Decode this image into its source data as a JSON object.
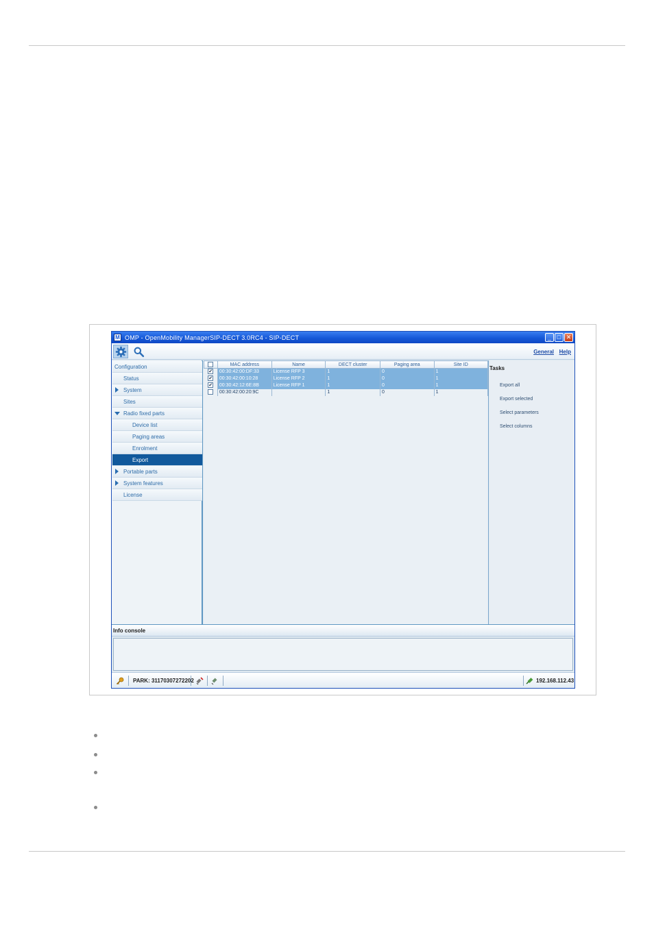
{
  "window": {
    "title": "OMP - OpenMobility ManagerSIP-DECT 3.0RC4 - SIP-DECT",
    "app_icon": "M",
    "controls": {
      "minimize": "_",
      "maximize": "□",
      "close": "✕"
    }
  },
  "toolbar": {
    "tools": [
      "gear-icon",
      "search-icon"
    ],
    "links": {
      "general": "General",
      "help": "Help"
    }
  },
  "nav": {
    "items": [
      {
        "label": "Configuration",
        "level": 0,
        "arrow": ""
      },
      {
        "label": "Status",
        "level": 1,
        "arrow": ""
      },
      {
        "label": "System",
        "level": 1,
        "arrow": "right"
      },
      {
        "label": "Sites",
        "level": 1,
        "arrow": ""
      },
      {
        "label": "Radio fixed parts",
        "level": 1,
        "arrow": "down"
      },
      {
        "label": "Device list",
        "level": 2,
        "arrow": ""
      },
      {
        "label": "Paging areas",
        "level": 2,
        "arrow": ""
      },
      {
        "label": "Enrolment",
        "level": 2,
        "arrow": ""
      },
      {
        "label": "Export",
        "level": 2,
        "arrow": "",
        "selected": true
      },
      {
        "label": "Portable parts",
        "level": 1,
        "arrow": "right"
      },
      {
        "label": "System features",
        "level": 1,
        "arrow": "right"
      },
      {
        "label": "License",
        "level": 1,
        "arrow": ""
      }
    ]
  },
  "table": {
    "columns": [
      "MAC address",
      "Name",
      "DECT cluster",
      "Paging area",
      "Site ID"
    ],
    "rows": [
      {
        "checked": true,
        "selected": true,
        "cells": [
          "00:30:42:00:DF:33",
          "License RFP 3",
          "1",
          "0",
          "1"
        ]
      },
      {
        "checked": true,
        "selected": true,
        "cells": [
          "00:30:42:00:10:28",
          "License RFP 2",
          "1",
          "0",
          "1"
        ]
      },
      {
        "checked": true,
        "selected": true,
        "cells": [
          "00:30:42:12:6E:8B",
          "License RFP 1",
          "1",
          "0",
          "1"
        ]
      },
      {
        "checked": false,
        "selected": false,
        "cells": [
          "00:30:42:00:20:9C",
          "",
          "1",
          "0",
          "1"
        ]
      }
    ],
    "check_mark": "✔"
  },
  "tasks": {
    "title": "Tasks",
    "items": [
      "Export all",
      "Export selected",
      "Select parameters",
      "Select columns"
    ]
  },
  "console": {
    "title": "Info console"
  },
  "status": {
    "park": "PARK: 31170307272202",
    "ip": "192.168.112.43",
    "icons": [
      "key-icon",
      "disconnected-plug-icon",
      "plug-icon",
      "connected-plug-icon"
    ]
  }
}
